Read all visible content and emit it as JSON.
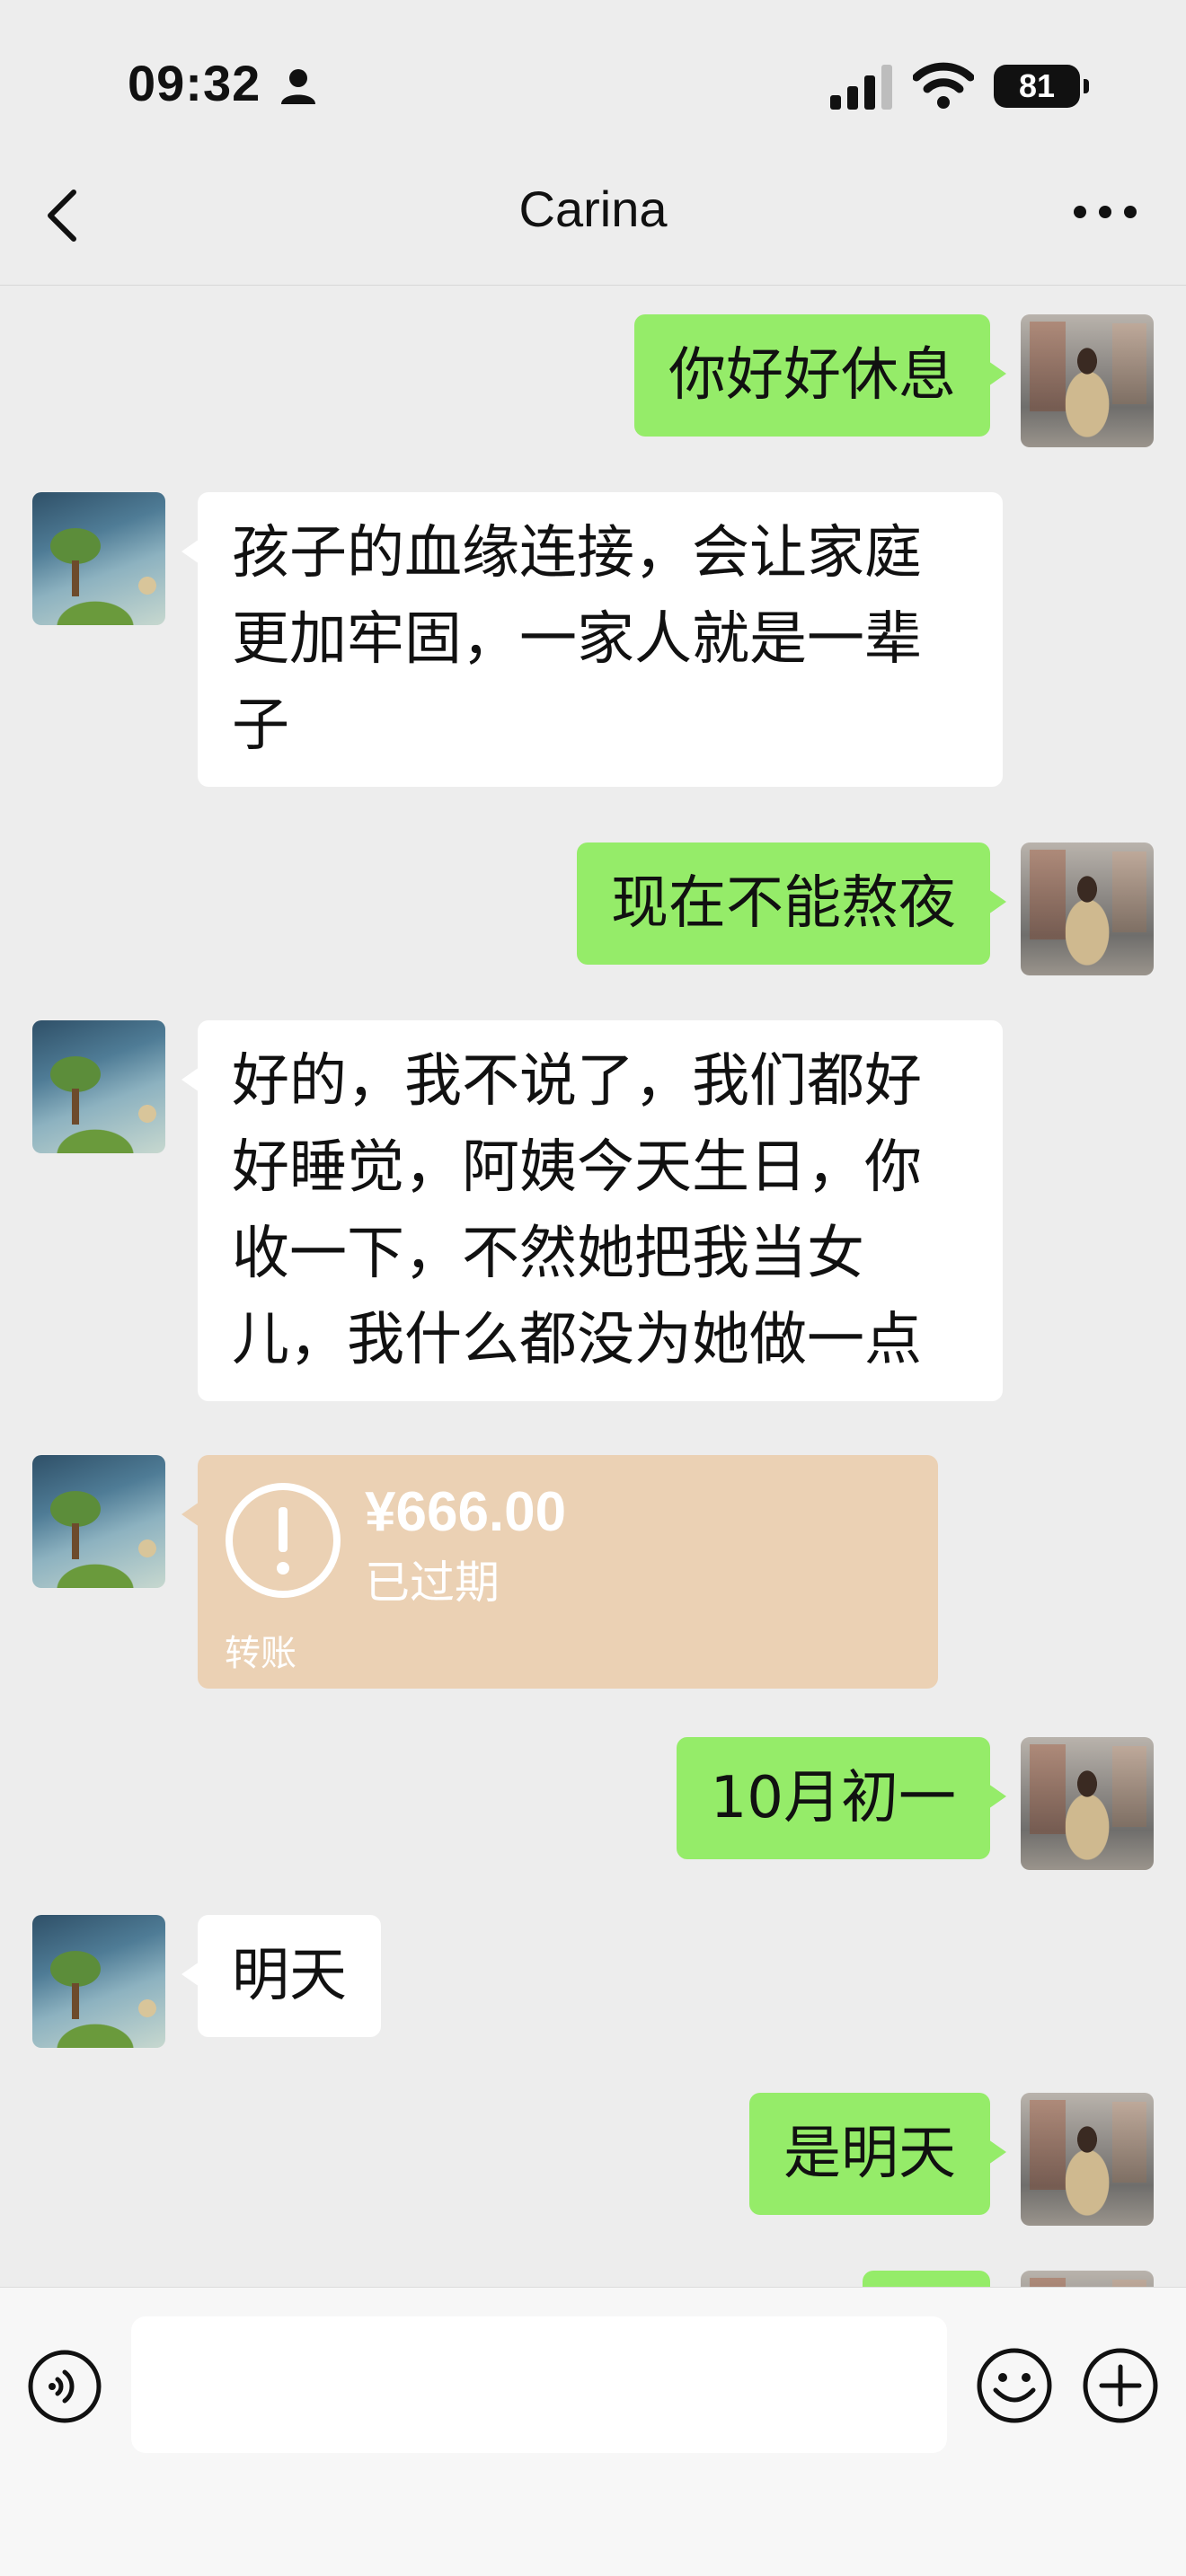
{
  "status_bar": {
    "time": "09:32",
    "battery": "81"
  },
  "header": {
    "title": "Carina"
  },
  "messages": [
    {
      "sender": "me",
      "text": "你好好休息"
    },
    {
      "sender": "them",
      "lines": [
        "孩子的血缘连接，会让家庭",
        "更加牢固，一家人就是一辈",
        "子"
      ]
    },
    {
      "sender": "me",
      "text": "现在不能熬夜"
    },
    {
      "sender": "them",
      "lines": [
        "好的，我不说了，我们都好",
        "好睡觉，阿姨今天生日，你",
        "收一下，不然她把我当女",
        "儿，我什么都没为她做一点"
      ]
    },
    {
      "sender": "them",
      "type": "transfer",
      "amount": "¥666.00",
      "status": "已过期",
      "label": "转账"
    },
    {
      "sender": "me",
      "text": "10月初一"
    },
    {
      "sender": "them",
      "text": "明天"
    },
    {
      "sender": "me",
      "text": "是明天"
    }
  ],
  "input": {
    "value": "",
    "placeholder": ""
  },
  "colors": {
    "background": "#ededed",
    "my_bubble": "#95ec69",
    "their_bubble": "#ffffff",
    "transfer_card": "#ebd1b4"
  }
}
